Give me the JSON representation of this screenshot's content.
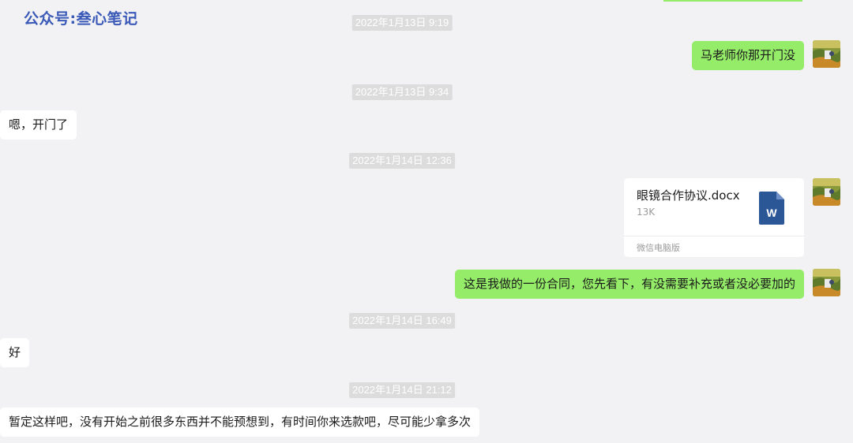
{
  "watermark": "公众号:叁心笔记",
  "timestamps": [
    "2022年1月13日 9:19",
    "2022年1月13日 9:34",
    "2022年1月14日 12:36",
    "2022年1月14日 16:49",
    "2022年1月14日 21:12"
  ],
  "messages": {
    "m1": "马老师你那开门没",
    "m2": "嗯，开门了",
    "file": {
      "name": "眼镜合作协议.docx",
      "size": "13K",
      "source": "微信电脑版",
      "icon": "word-document-icon",
      "icon_letter": "W"
    },
    "m3": "这是我做的一份合同，您先看下，有没需要补充或者没必要加的",
    "m4": "好",
    "m5": "暂定这样吧，没有开始之前很多东西并不能预想到，有时间你来选款吧，尽可能少拿多次"
  },
  "colors": {
    "background": "#f2f2f4",
    "outgoing_bubble": "#95ec69",
    "incoming_bubble": "#ffffff",
    "timestamp_bg": "#dcdcdc",
    "watermark": "#3b5ab8",
    "word_icon": "#2b5797"
  }
}
